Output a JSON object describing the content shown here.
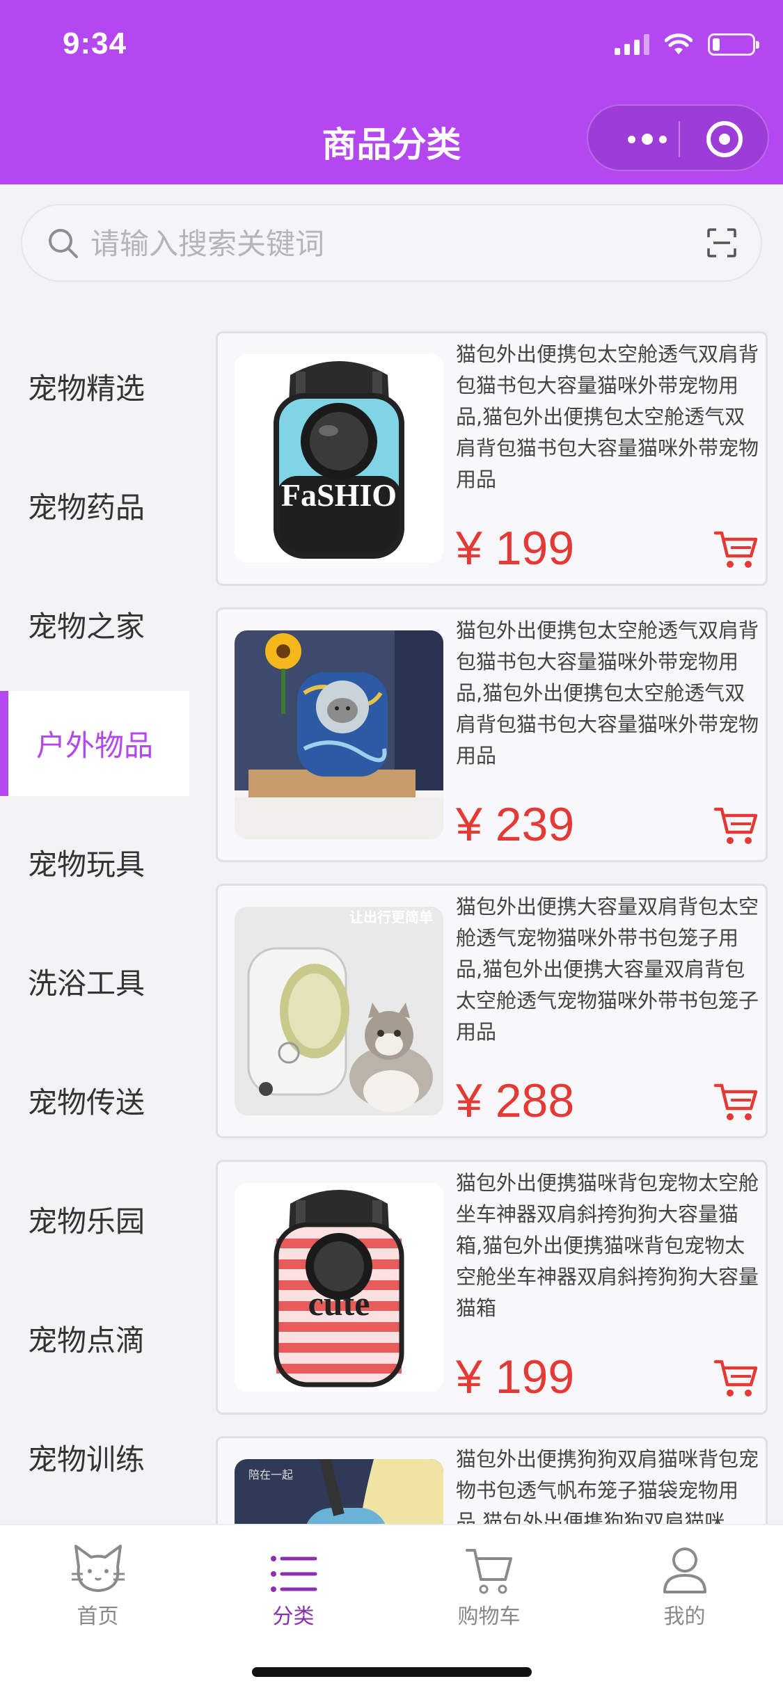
{
  "status_bar": {
    "time": "9:34"
  },
  "header": {
    "title": "商品分类"
  },
  "search": {
    "placeholder": "请输入搜索关键词"
  },
  "sidebar": {
    "items": [
      {
        "label": "宠物精选",
        "active": false
      },
      {
        "label": "宠物药品",
        "active": false
      },
      {
        "label": "宠物之家",
        "active": false
      },
      {
        "label": "户外物品",
        "active": true
      },
      {
        "label": "宠物玩具",
        "active": false
      },
      {
        "label": "洗浴工具",
        "active": false
      },
      {
        "label": "宠物传送",
        "active": false
      },
      {
        "label": "宠物乐园",
        "active": false
      },
      {
        "label": "宠物点滴",
        "active": false
      },
      {
        "label": "宠物训练",
        "active": false
      }
    ]
  },
  "products": [
    {
      "title": "猫包外出便携包太空舱透气双肩背包猫书包大容量猫咪外带宠物用品,猫包外出便携包太空舱透气双肩背包猫书包大容量猫咪外带宠物用品",
      "price": "¥ 199"
    },
    {
      "title": "猫包外出便携包太空舱透气双肩背包猫书包大容量猫咪外带宠物用品,猫包外出便携包太空舱透气双肩背包猫书包大容量猫咪外带宠物用品",
      "price": "¥ 239"
    },
    {
      "title": "猫包外出便携大容量双肩背包太空舱透气宠物猫咪外带书包笼子用品,猫包外出便携大容量双肩背包太空舱透气宠物猫咪外带书包笼子用品",
      "price": "¥ 288",
      "image_text": "让出行更简单"
    },
    {
      "title": "猫包外出便携猫咪背包宠物太空舱坐车神器双肩斜挎狗狗大容量猫箱,猫包外出便携猫咪背包宠物太空舱坐车神器双肩斜挎狗狗大容量猫箱",
      "price": "¥ 199"
    },
    {
      "title": "猫包外出便携狗狗双肩猫咪背包宠物书包透气帆布笼子猫袋宠物用品,猫包外出便携狗狗双肩猫咪",
      "price": "",
      "image_text": "陪在一起"
    }
  ],
  "tabbar": {
    "items": [
      {
        "label": "首页",
        "icon": "cat-icon",
        "active": false
      },
      {
        "label": "分类",
        "icon": "list-icon",
        "active": true
      },
      {
        "label": "购物车",
        "icon": "cart-icon",
        "active": false
      },
      {
        "label": "我的",
        "icon": "user-icon",
        "active": false
      }
    ]
  },
  "colors": {
    "brand": "#b347f0",
    "price": "#e53935",
    "active_tab": "#8b2fb0"
  }
}
